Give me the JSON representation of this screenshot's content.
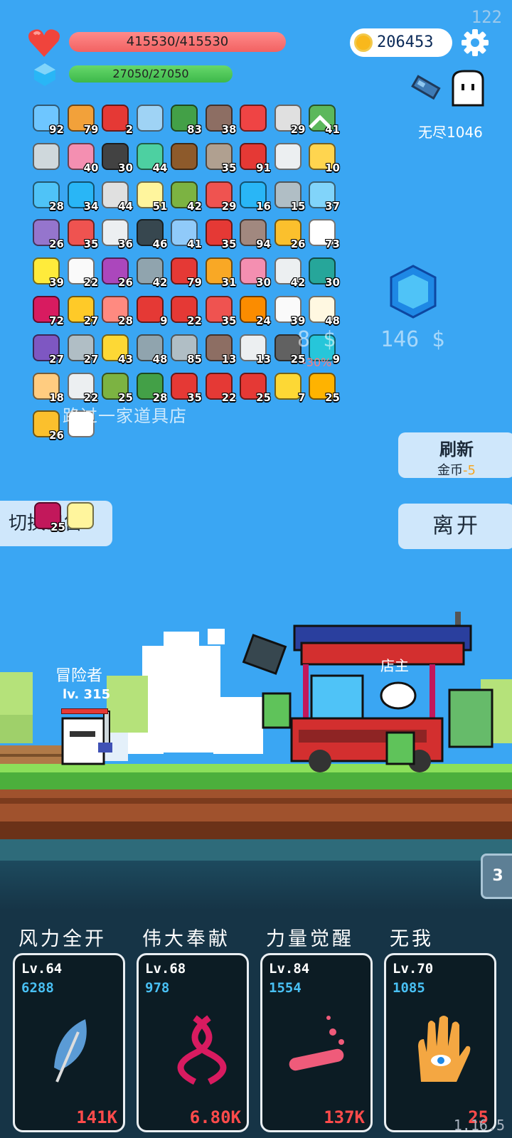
{
  "corner_number": "122",
  "version": "1.16.5",
  "hp": {
    "text": "415530/415530",
    "fraction": 1.0
  },
  "mp": {
    "text": "27050/27050",
    "fraction": 1.0
  },
  "coins": "206453",
  "endless_label": "无尽1046",
  "inventory": [
    {
      "icon": "star-card-icon",
      "color": "#6ec6ff",
      "count": "92"
    },
    {
      "icon": "book-icon",
      "color": "#f2a13a",
      "count": "79"
    },
    {
      "icon": "magnet-icon",
      "color": "#e53935",
      "count": "2"
    },
    {
      "icon": "magnifier-icon",
      "color": "#9fd3f5",
      "count": ""
    },
    {
      "icon": "watermelon-icon",
      "color": "#43a047",
      "count": "83"
    },
    {
      "icon": "coconut-icon",
      "color": "#8d6e63",
      "count": "38"
    },
    {
      "icon": "percent-tag-icon",
      "color": "#ef4444",
      "count": ""
    },
    {
      "icon": "alarm-clock-icon",
      "color": "#e0e0e0",
      "count": "29"
    },
    {
      "icon": "cash-heart-icon",
      "color": "#5cb85c",
      "count": "41"
    },
    {
      "icon": "sickle-icon",
      "color": "#cfd8dc",
      "count": ""
    },
    {
      "icon": "ice-cream-icon",
      "color": "#f48fb1",
      "count": "40"
    },
    {
      "icon": "cauldron-icon",
      "color": "#424242",
      "count": "30"
    },
    {
      "icon": "slime-icon",
      "color": "#4dd0a1",
      "count": "44"
    },
    {
      "icon": "treasure-chest-icon",
      "color": "#8d5a2b",
      "count": ""
    },
    {
      "icon": "stone-door-icon",
      "color": "#b0a090",
      "count": "35"
    },
    {
      "icon": "apple-icon",
      "color": "#e53935",
      "count": "91"
    },
    {
      "icon": "wing-icon",
      "color": "#eceff1",
      "count": ""
    },
    {
      "icon": "magic-wand-icon",
      "color": "#ffd54f",
      "count": "10"
    },
    {
      "icon": "scroll-icon",
      "color": "#4fc3f7",
      "count": "28"
    },
    {
      "icon": "speech-bubble-icon",
      "color": "#29b6f6",
      "count": "34"
    },
    {
      "icon": "half-moon-icon",
      "color": "#e0e0e0",
      "count": "44"
    },
    {
      "icon": "halo-icon",
      "color": "#fff59d",
      "count": "51"
    },
    {
      "icon": "grenade-icon",
      "color": "#7cb342",
      "count": "42"
    },
    {
      "icon": "pill-icon",
      "color": "#ef5350",
      "count": "29"
    },
    {
      "icon": "sapphire-icon",
      "color": "#29b6f6",
      "count": "16"
    },
    {
      "icon": "fishing-hook-icon",
      "color": "#b0bec5",
      "count": "15"
    },
    {
      "icon": "blue-cat-icon",
      "color": "#81d4fa",
      "count": "37"
    },
    {
      "icon": "purple-box-icon",
      "color": "#9575cd",
      "count": "26"
    },
    {
      "icon": "heart-icon",
      "color": "#ef5350",
      "count": "35"
    },
    {
      "icon": "envelope-icon",
      "color": "#eceff1",
      "count": "36"
    },
    {
      "icon": "bat-icon",
      "color": "#37474f",
      "count": "46"
    },
    {
      "icon": "blue-pill-icon",
      "color": "#90caf9",
      "count": "41"
    },
    {
      "icon": "strawberry-icon",
      "color": "#e53935",
      "count": "35"
    },
    {
      "icon": "donut-icon",
      "color": "#a1887f",
      "count": "94"
    },
    {
      "icon": "sunflower-icon",
      "color": "#fbc02d",
      "count": "26"
    },
    {
      "icon": "daisy-icon",
      "color": "#ffffff",
      "count": "73"
    },
    {
      "icon": "sun-icon",
      "color": "#ffeb3b",
      "count": "39"
    },
    {
      "icon": "ghost-icon",
      "color": "#fafafa",
      "count": "22"
    },
    {
      "icon": "purple-orb-icon",
      "color": "#ab47bc",
      "count": "26"
    },
    {
      "icon": "shield-icon",
      "color": "#90a4ae",
      "count": "42"
    },
    {
      "icon": "red-sock-icon",
      "color": "#e53935",
      "count": "79"
    },
    {
      "icon": "parchment-icon",
      "color": "#f9a825",
      "count": "31"
    },
    {
      "icon": "potion-jar-icon",
      "color": "#f48fb1",
      "count": "30"
    },
    {
      "icon": "playing-cards-icon",
      "color": "#eceff1",
      "count": "42"
    },
    {
      "icon": "teal-ring-icon",
      "color": "#26a69a",
      "count": "30"
    },
    {
      "icon": "jam-jar-icon",
      "color": "#d81b60",
      "count": "72"
    },
    {
      "icon": "notepad-icon",
      "color": "#ffca28",
      "count": "27"
    },
    {
      "icon": "meat-icon",
      "color": "#ff8a80",
      "count": "28"
    },
    {
      "icon": "twin-hearts-icon",
      "color": "#e53935",
      "count": "9"
    },
    {
      "icon": "red-badge-icon",
      "color": "#e53935",
      "count": "22"
    },
    {
      "icon": "gift-box-icon",
      "color": "#ef5350",
      "count": "35"
    },
    {
      "icon": "flag-icon",
      "color": "#fb8c00",
      "count": "24"
    },
    {
      "icon": "dice-icon",
      "color": "#fafafa",
      "count": "39"
    },
    {
      "icon": "fried-egg-icon",
      "color": "#fff8e1",
      "count": "48"
    },
    {
      "icon": "purple-star-shield-icon",
      "color": "#7e57c2",
      "count": "27"
    },
    {
      "icon": "stopwatch-icon",
      "color": "#b0bec5",
      "count": "27"
    },
    {
      "icon": "crown-icon",
      "color": "#fdd835",
      "count": "43"
    },
    {
      "icon": "stone-brain-icon",
      "color": "#90a4ae",
      "count": "48"
    },
    {
      "icon": "sword-icon",
      "color": "#b0bec5",
      "count": "85"
    },
    {
      "icon": "bow-icon",
      "color": "#8d6e63",
      "count": "13"
    },
    {
      "icon": "feather-pen-icon",
      "color": "#eceff1",
      "count": "13"
    },
    {
      "icon": "spiked-ball-icon",
      "color": "#616161",
      "count": "25"
    },
    {
      "icon": "crosshair-icon",
      "color": "#26c6da",
      "count": "9"
    },
    {
      "icon": "fist-icon",
      "color": "#ffcc80",
      "count": "18"
    },
    {
      "icon": "clipboard-icon",
      "color": "#eceff1",
      "count": "22"
    },
    {
      "icon": "green-monster-icon",
      "color": "#7cb342",
      "count": "25"
    },
    {
      "icon": "turtle-shell-icon",
      "color": "#43a047",
      "count": "28"
    },
    {
      "icon": "thermometer-icon",
      "color": "#e53935",
      "count": "35"
    },
    {
      "icon": "red-bookmark-icon",
      "color": "#e53935",
      "count": "22"
    },
    {
      "icon": "mushroom-icon",
      "color": "#e53935",
      "count": "25"
    },
    {
      "icon": "gold-ring-icon",
      "color": "#fdd835",
      "count": "7"
    },
    {
      "icon": "meteor-icon",
      "color": "#ffb300",
      "count": "25"
    },
    {
      "icon": "coin-stack-icon",
      "color": "#fbc02d",
      "count": "26"
    },
    {
      "icon": "chat-dots-icon",
      "color": "#ffffff",
      "count": ""
    }
  ],
  "bottom_slots": [
    {
      "icon": "striped-card-icon",
      "color": "#c2185b",
      "count": "25"
    },
    {
      "icon": "light-bulb-icon",
      "color": "#fff59d",
      "count": ""
    }
  ],
  "shop": {
    "price1": "8 $",
    "price2": "146 $",
    "discount": "-30%",
    "banner": "路过一家道具店",
    "shopkeeper_label": "店主"
  },
  "buttons": {
    "refresh_label": "刷新",
    "refresh_cost_prefix": "金币",
    "refresh_cost_value": "-5",
    "leave_label": "离开",
    "switch_label": "切换出售"
  },
  "hero": {
    "name": "冒险者",
    "level": "lv. 315",
    "hp_fraction": 1.0
  },
  "skills_tab_number": "3",
  "skills": [
    {
      "name": "风力全开",
      "level": "Lv.64",
      "value": "6288",
      "cost": "141K",
      "icon": "feather-icon",
      "color": "#5b9bd5"
    },
    {
      "name": "伟大奉献",
      "level": "Lv.68",
      "value": "978",
      "cost": "6.80K",
      "icon": "dna-icon",
      "color": "#d81b60"
    },
    {
      "name": "力量觉醒",
      "level": "Lv.84",
      "value": "1554",
      "cost": "137K",
      "icon": "test-tube-icon",
      "color": "#ef5b7a"
    },
    {
      "name": "无我",
      "level": "Lv.70",
      "value": "1085",
      "cost": "25",
      "icon": "eye-hand-icon",
      "color": "#f4a742"
    }
  ]
}
